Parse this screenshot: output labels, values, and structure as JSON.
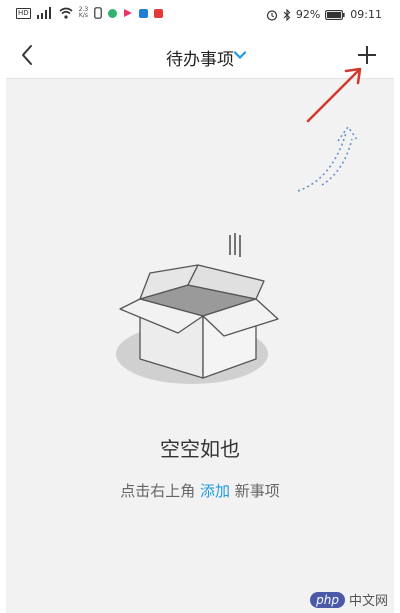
{
  "status_bar": {
    "hd": "HD",
    "speed_value": "2.3",
    "speed_unit": "K/s",
    "battery": "92%",
    "time": "09:11"
  },
  "navbar": {
    "title": "待办事项"
  },
  "empty_state": {
    "title": "空空如也",
    "hint_before": "点击右上角",
    "hint_link": "添加",
    "hint_after": "新事项"
  },
  "watermark": {
    "badge": "php",
    "text": "中文网"
  },
  "colors": {
    "accent": "#1e9be6",
    "annotation_arrow": "#d33a2f"
  }
}
